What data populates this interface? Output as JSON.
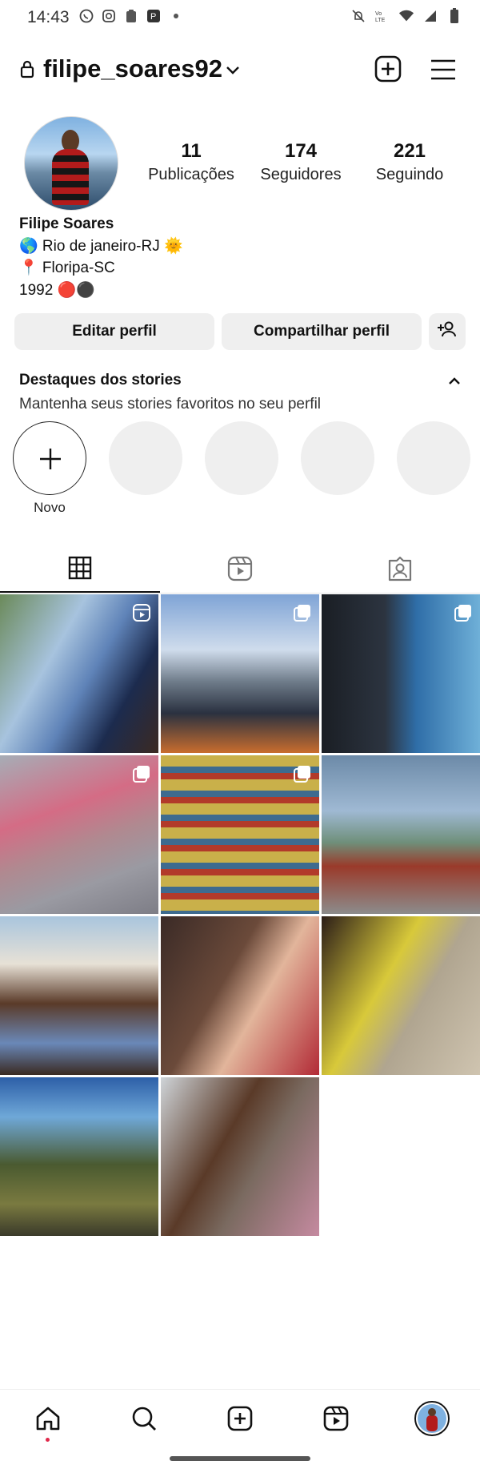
{
  "status_bar": {
    "time": "14:43",
    "icons_left": [
      "whatsapp-icon",
      "instagram-icon",
      "clipboard-icon",
      "app-icon",
      "dot-icon"
    ],
    "icons_right": [
      "mute-icon",
      "volte-icon",
      "wifi-icon",
      "signal-icon",
      "battery-icon"
    ]
  },
  "header": {
    "username": "filipe_soares92",
    "icons": [
      "lock-icon",
      "chevron-down-icon",
      "add-post-icon",
      "menu-icon"
    ]
  },
  "profile": {
    "stats": [
      {
        "num": "11",
        "label": "Publicações"
      },
      {
        "num": "174",
        "label": "Seguidores"
      },
      {
        "num": "221",
        "label": "Seguindo"
      }
    ],
    "name": "Filipe Soares",
    "bio_lines": [
      "🌎 Rio de janeiro-RJ 🌞",
      "📍 Floripa-SC",
      "1992 🔴⚫"
    ]
  },
  "buttons": {
    "edit": "Editar perfil",
    "share": "Compartilhar perfil",
    "add_person_icon": "add-person-icon"
  },
  "highlights": {
    "title": "Destaques dos stories",
    "subtitle": "Mantenha seus stories favoritos no seu perfil",
    "new_label": "Novo"
  },
  "tabs": [
    "grid-icon",
    "reels-icon",
    "tagged-icon"
  ],
  "posts": [
    {
      "id": "p1",
      "type": "reel"
    },
    {
      "id": "p2",
      "type": "carousel"
    },
    {
      "id": "p3",
      "type": "carousel"
    },
    {
      "id": "p4",
      "type": "carousel"
    },
    {
      "id": "p5",
      "type": "carousel"
    },
    {
      "id": "p6",
      "type": "photo"
    },
    {
      "id": "p7",
      "type": "photo"
    },
    {
      "id": "p8",
      "type": "photo"
    },
    {
      "id": "p9",
      "type": "photo"
    },
    {
      "id": "p10",
      "type": "photo"
    },
    {
      "id": "p11",
      "type": "photo"
    }
  ],
  "bottom_nav": [
    "home-icon",
    "search-icon",
    "create-icon",
    "reels-nav-icon",
    "profile-avatar"
  ]
}
